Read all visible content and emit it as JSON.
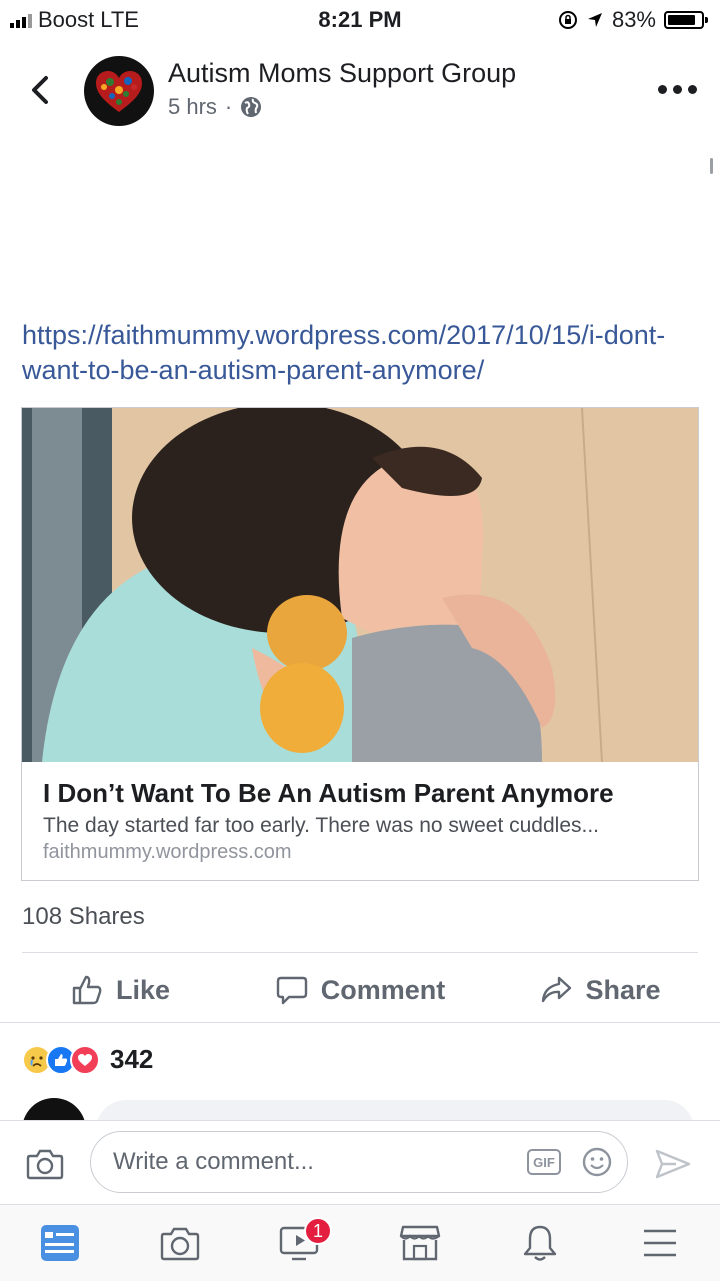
{
  "status_bar": {
    "carrier": "Boost",
    "network": "LTE",
    "time": "8:21 PM",
    "battery": "83%",
    "battery_level": 0.83
  },
  "post": {
    "group_name": "Autism Moms Support Group",
    "time_ago": "5 hrs",
    "separator": "·",
    "link_url": "https://faithmummy.wordpress.com/2017/10/15/i-dont-want-to-be-an-autism-parent-anymore/",
    "preview": {
      "title": "I Don’t Want To Be An Autism Parent Anymore",
      "description": "The day started far too early. There was no sweet cuddles...",
      "domain": "faithmummy.wordpress.com"
    },
    "shares": "108 Shares",
    "reaction_count": "342"
  },
  "actions": {
    "like": "Like",
    "comment": "Comment",
    "share": "Share"
  },
  "composer": {
    "placeholder": "Write a comment...",
    "gif_label": "GIF"
  },
  "tabbar": {
    "video_badge": "1"
  },
  "icons": [
    "back-icon",
    "globe-icon",
    "more-icon",
    "like-icon",
    "comment-icon",
    "share-icon",
    "camera-icon",
    "gif-icon",
    "emoji-icon",
    "send-icon",
    "news-feed-icon",
    "video-icon",
    "marketplace-icon",
    "notifications-icon",
    "menu-icon"
  ],
  "colors": {
    "link": "#385898",
    "accent": "#4267b2",
    "badge": "#e41e3f"
  }
}
